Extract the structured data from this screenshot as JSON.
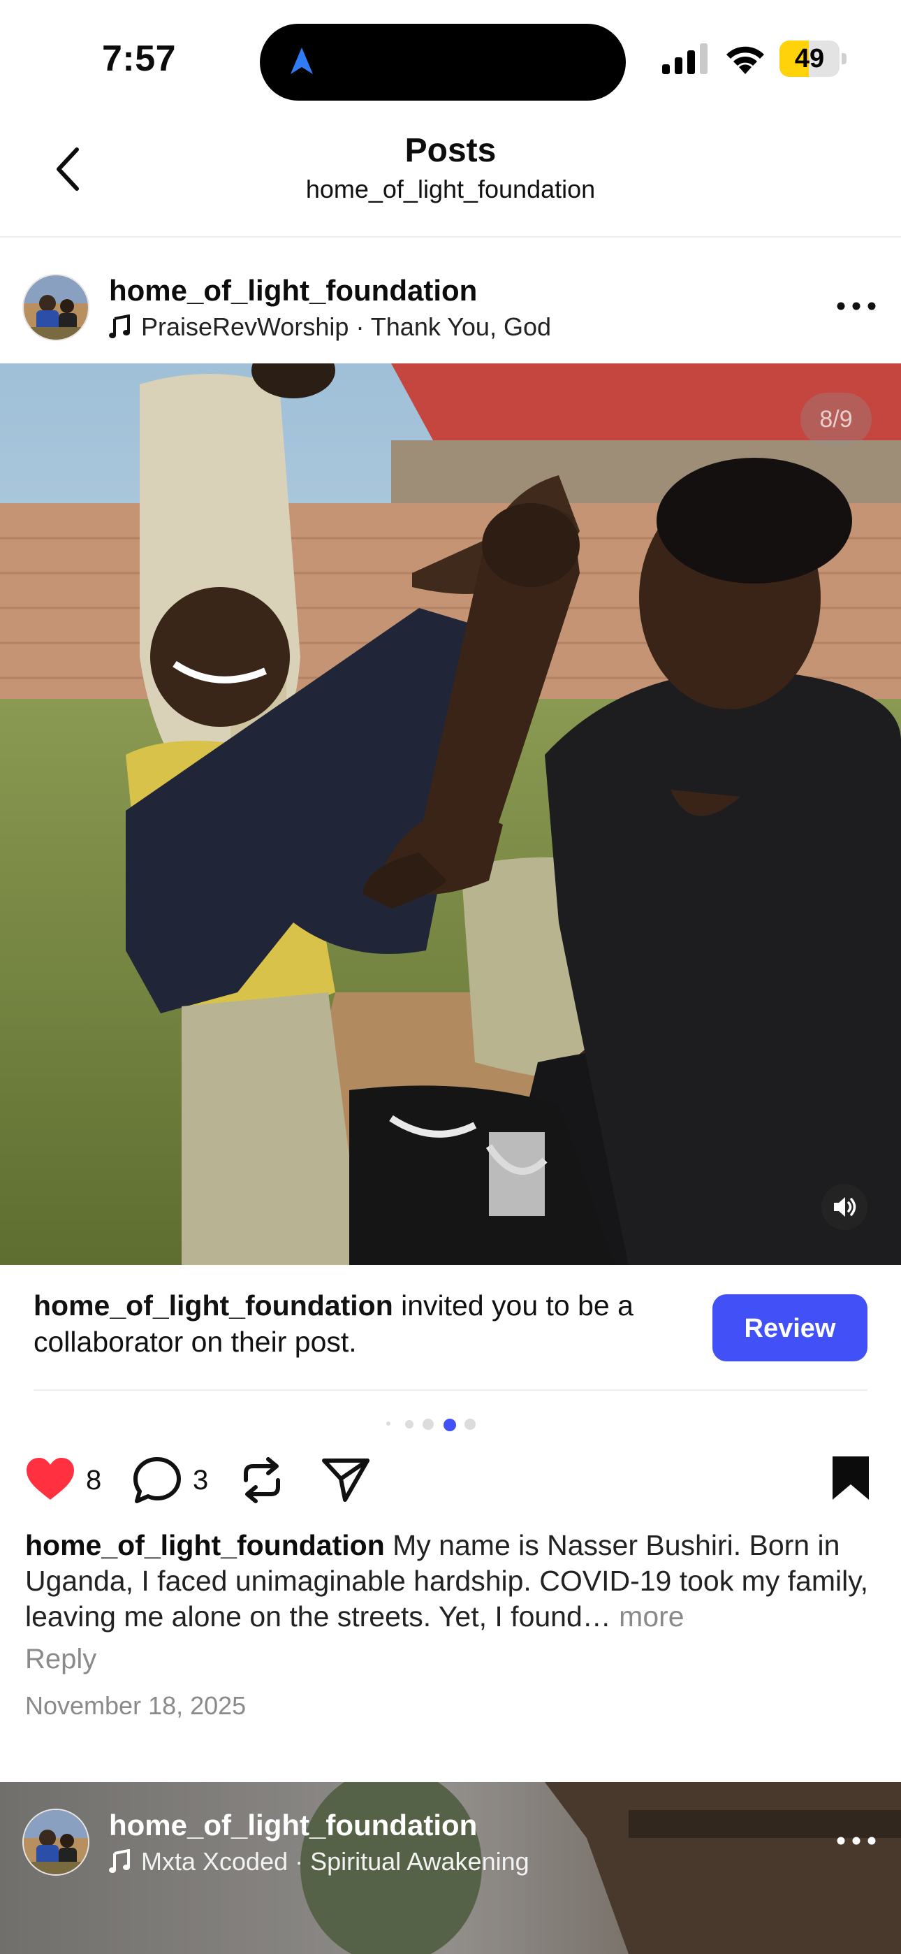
{
  "status_bar": {
    "time": "7:57",
    "battery": "49",
    "battery_level": 0.49,
    "icons": [
      "location-arrow-icon",
      "cellular-signal-icon",
      "wifi-icon",
      "battery-icon"
    ]
  },
  "header": {
    "title": "Posts",
    "subtitle": "home_of_light_foundation",
    "back_icon": "chevron-left-icon"
  },
  "post": {
    "username": "home_of_light_foundation",
    "audio": "PraiseRevWorship · Thank You, God",
    "counter": "8/9",
    "collab": {
      "username": "home_of_light_foundation",
      "message": " invited you to be a collaborator on their post.",
      "button": "Review"
    },
    "carousel": {
      "current": 4,
      "total": 5
    },
    "likes": "8",
    "comments": "3",
    "caption_username": "home_of_light_foundation",
    "caption_text": " My name is Nasser Bushiri. Born in Uganda, I faced unimaginable hardship. COVID-19 took my family, leaving me alone on the streets. Yet, I found… ",
    "more": "more",
    "reply": "Reply",
    "date": "November 18, 2025",
    "colors": {
      "like": "#ff3040",
      "accent": "#4150f7",
      "dot_active": "#4150f7"
    }
  },
  "next_post": {
    "username": "home_of_light_foundation",
    "audio": "Mxta Xcoded · Spiritual Awakening"
  }
}
